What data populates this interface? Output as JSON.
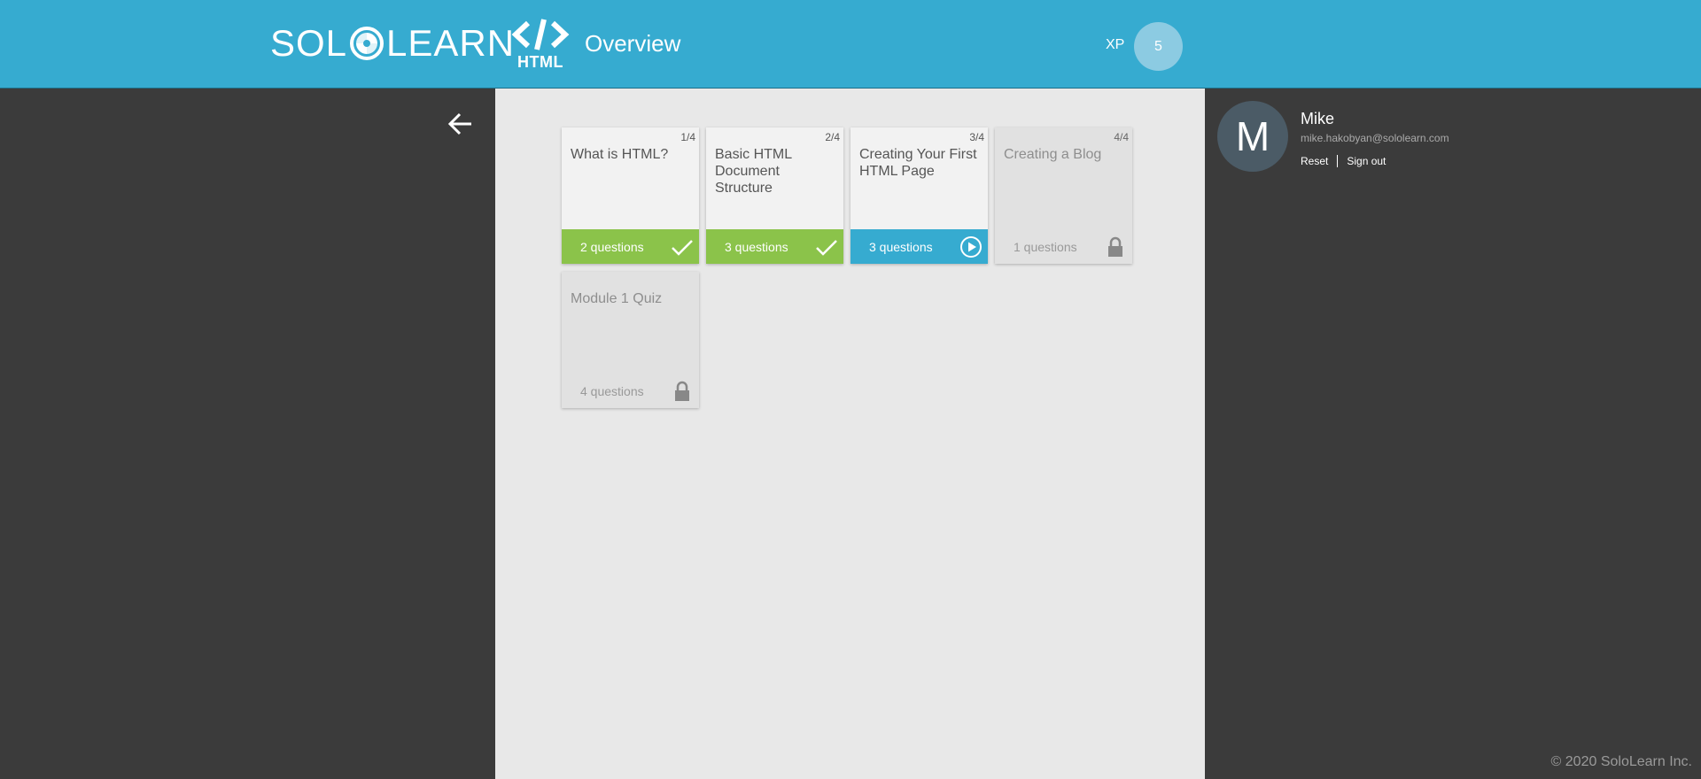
{
  "header": {
    "logo_left": "SOL",
    "logo_right": "LEARN",
    "course_badge": "HTML",
    "title": "Overview",
    "xp_label": "XP",
    "xp_value": "5",
    "colors": {
      "bar": "#36abd0",
      "xp_badge": "#8ccbe2"
    }
  },
  "lessons": [
    {
      "number": "1/4",
      "title": "What is HTML?",
      "questions": "2 questions",
      "status": "completed"
    },
    {
      "number": "2/4",
      "title": "Basic HTML Document Structure",
      "questions": "3 questions",
      "status": "completed"
    },
    {
      "number": "3/4",
      "title": "Creating Your First HTML Page",
      "questions": "3 questions",
      "status": "current"
    },
    {
      "number": "4/4",
      "title": "Creating a Blog",
      "questions": "1 questions",
      "status": "locked"
    },
    {
      "number": "",
      "title": "Module 1 Quiz",
      "questions": "4 questions",
      "status": "locked"
    }
  ],
  "user": {
    "initial": "M",
    "name": "Mike",
    "email": "mike.hakobyan@sololearn.com",
    "reset_label": "Reset",
    "signout_label": "Sign out"
  },
  "footer": {
    "copyright": "© 2020 SoloLearn Inc."
  },
  "colors": {
    "completed": "#8bc34a",
    "current": "#36abd0",
    "sidebar": "#3b3b3b",
    "content": "#e8e8e8"
  }
}
